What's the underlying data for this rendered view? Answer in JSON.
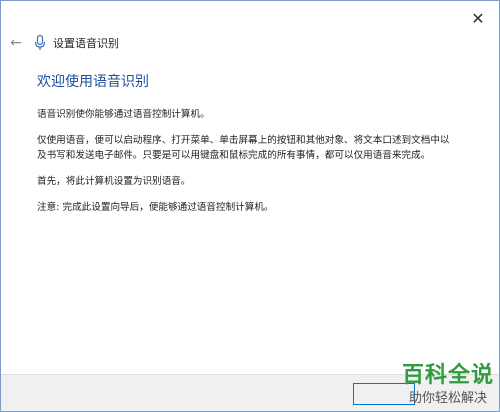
{
  "window": {
    "close_glyph": "✕",
    "back_glyph": "←",
    "title": "设置语音识别"
  },
  "content": {
    "heading": "欢迎使用语音识别",
    "paragraphs": [
      "语音识别使你能够通过语音控制计算机。",
      "仅使用语音，便可以启动程序、打开菜单、单击屏幕上的按钮和其他对象、将文本口述到文档中以及书写和发送电子邮件。只要是可以用键盘和鼠标完成的所有事情，都可以仅用语音来完成。",
      "首先，将此计算机设置为识别语音。",
      "注意: 完成此设置向导后，便能够通过语音控制计算机。"
    ]
  },
  "watermark": {
    "title": "百科全说",
    "subtitle": "助你轻松解决"
  }
}
